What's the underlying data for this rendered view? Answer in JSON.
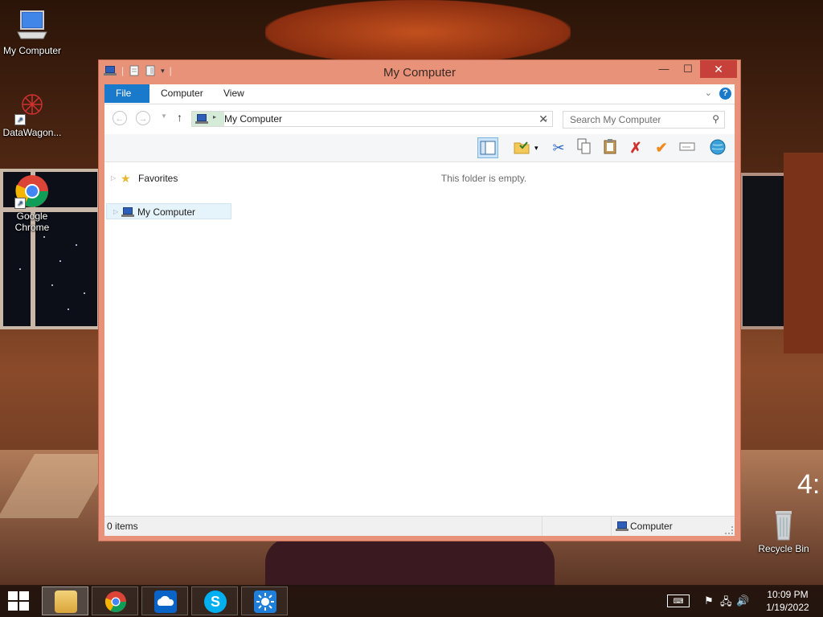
{
  "desktop": {
    "icons": [
      {
        "label": "My Computer"
      },
      {
        "label": "DataWagon..."
      },
      {
        "label": "Google Chrome"
      },
      {
        "label": "Recycle Bin"
      }
    ],
    "overlay_clock_text": "4:"
  },
  "window": {
    "title": "My Computer",
    "controls": {
      "minimize": "—",
      "maximize": "☐",
      "close": "✕"
    },
    "ribbon": {
      "tabs": [
        "File",
        "Computer",
        "View"
      ],
      "help": "?"
    },
    "address": {
      "path": "My Computer",
      "search_placeholder": "Search My Computer"
    },
    "nav_pane": {
      "items": [
        {
          "label": "Favorites",
          "icon": "star-icon"
        },
        {
          "label": "My Computer",
          "icon": "computer-icon",
          "selected": true
        }
      ]
    },
    "content": {
      "empty_message": "This folder is empty."
    },
    "status": {
      "item_count": "0 items",
      "zone": "Computer"
    }
  },
  "taskbar": {
    "apps": [
      "file-explorer",
      "google-chrome",
      "onedrive",
      "skype",
      "weather"
    ],
    "clock": {
      "time": "10:09 PM",
      "date": "1/19/2022"
    }
  },
  "colors": {
    "window_frame": "#e8927a",
    "close_button": "#c8403a",
    "file_tab": "#1979ca"
  }
}
